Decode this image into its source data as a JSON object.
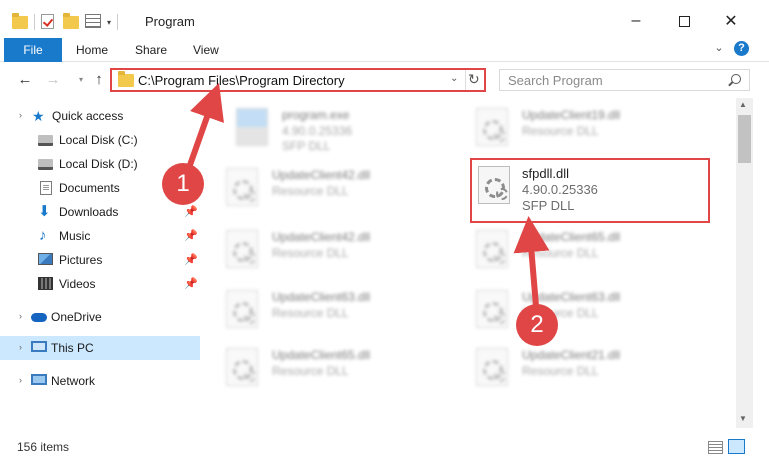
{
  "window": {
    "title": "Program",
    "controls": {
      "minimize": "–",
      "close": "✕"
    }
  },
  "quick_access_toolbar": {
    "icons": [
      "folder-icon",
      "properties-check-icon",
      "new-folder-icon",
      "customize-icon"
    ],
    "caret": "▾"
  },
  "ribbon": {
    "tabs": [
      "File",
      "Home",
      "Share",
      "View"
    ],
    "expand_glyph": "⌄",
    "help_glyph": "?"
  },
  "navigation": {
    "back_glyph": "←",
    "forward_glyph": "→",
    "recent_glyph": "▾",
    "up_glyph": "↑",
    "address_path": "C:\\Program Files\\Program Directory",
    "address_dropdown_glyph": "⌄",
    "refresh_glyph": "↻",
    "search_placeholder": "Search Program"
  },
  "sidebar": {
    "quick_access": "Quick access",
    "items": [
      {
        "label": "Local Disk (C:)",
        "icon": "drive-icon",
        "pinned": false
      },
      {
        "label": "Local Disk (D:)",
        "icon": "drive-icon",
        "pinned": false
      },
      {
        "label": "Documents",
        "icon": "documents-icon",
        "pinned": true
      },
      {
        "label": "Downloads",
        "icon": "downloads-icon",
        "pinned": true
      },
      {
        "label": "Music",
        "icon": "music-icon",
        "pinned": true
      },
      {
        "label": "Pictures",
        "icon": "pictures-icon",
        "pinned": true
      },
      {
        "label": "Videos",
        "icon": "videos-icon",
        "pinned": true
      }
    ],
    "pin_glyph": "📌",
    "onedrive": "OneDrive",
    "this_pc": "This PC",
    "network": "Network",
    "chevron": "›",
    "star_glyph": "★",
    "download_glyph": "⬇",
    "music_glyph": "♪"
  },
  "files": [
    {
      "name": "program.exe",
      "line2": "4.90.0.25336",
      "line3": "SFP DLL",
      "icon": "exe-icon"
    },
    {
      "name": "UpdateClient19.dll",
      "line2": "Resource DLL",
      "line3": "",
      "icon": "dll-icon"
    },
    {
      "name": "UpdateClient42.dll",
      "line2": "Resource DLL",
      "line3": "",
      "icon": "dll-icon"
    },
    {
      "name": "sfpdll.dll",
      "line2": "4.90.0.25336",
      "line3": "SFP DLL",
      "icon": "dll-icon",
      "highlighted": true
    },
    {
      "name": "UpdateClient42.dll",
      "line2": "Resource DLL",
      "line3": "",
      "icon": "dll-icon"
    },
    {
      "name": "UpdateClient65.dll",
      "line2": "Resource DLL",
      "line3": "",
      "icon": "dll-icon"
    },
    {
      "name": "UpdateClient63.dll",
      "line2": "Resource DLL",
      "line3": "",
      "icon": "dll-icon"
    },
    {
      "name": "UpdateClient63.dll",
      "line2": "Resource DLL",
      "line3": "",
      "icon": "dll-icon"
    },
    {
      "name": "UpdateClient65.dll",
      "line2": "Resource DLL",
      "line3": "",
      "icon": "dll-icon"
    },
    {
      "name": "UpdateClient21.dll",
      "line2": "Resource DLL",
      "line3": "",
      "icon": "dll-icon"
    }
  ],
  "scrollbar": {
    "up_glyph": "▲",
    "down_glyph": "▼"
  },
  "status": {
    "item_count": "156 items"
  },
  "annotations": {
    "badge_1": "1",
    "badge_2": "2",
    "color": "#e04646"
  },
  "colors": {
    "accent": "#1979ca",
    "selection": "#cce8ff",
    "highlight": "#e04646"
  }
}
